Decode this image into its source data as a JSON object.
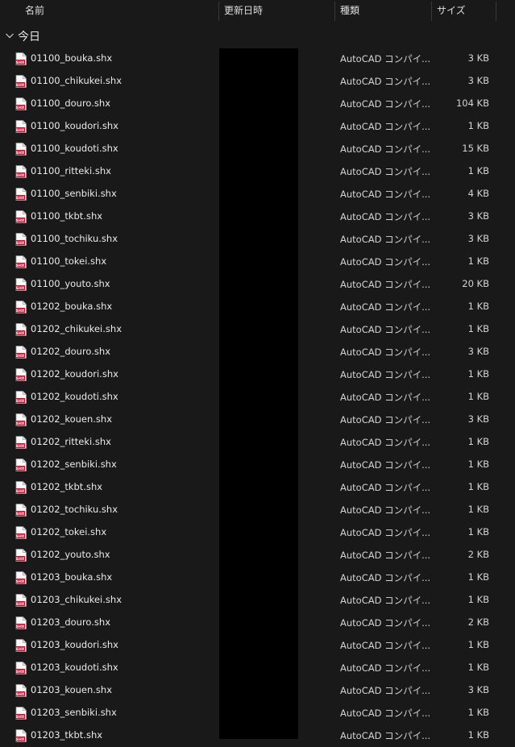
{
  "columns": {
    "name": "名前",
    "date": "更新日時",
    "type": "種類",
    "size": "サイズ"
  },
  "sort_indicator": "^",
  "group": {
    "label": "今日"
  },
  "icon": "shx-file-icon",
  "colors": {
    "background": "#191919",
    "text": "#eaeaea",
    "icon_red": "#c8102e",
    "redaction": "#000000"
  },
  "files": [
    {
      "name": "01100_bouka.shx",
      "type": "AutoCAD コンパイ...",
      "size": "3 KB"
    },
    {
      "name": "01100_chikukei.shx",
      "type": "AutoCAD コンパイ...",
      "size": "3 KB"
    },
    {
      "name": "01100_douro.shx",
      "type": "AutoCAD コンパイ...",
      "size": "104 KB"
    },
    {
      "name": "01100_koudori.shx",
      "type": "AutoCAD コンパイ...",
      "size": "1 KB"
    },
    {
      "name": "01100_koudoti.shx",
      "type": "AutoCAD コンパイ...",
      "size": "15 KB"
    },
    {
      "name": "01100_ritteki.shx",
      "type": "AutoCAD コンパイ...",
      "size": "1 KB"
    },
    {
      "name": "01100_senbiki.shx",
      "type": "AutoCAD コンパイ...",
      "size": "4 KB"
    },
    {
      "name": "01100_tkbt.shx",
      "type": "AutoCAD コンパイ...",
      "size": "3 KB"
    },
    {
      "name": "01100_tochiku.shx",
      "type": "AutoCAD コンパイ...",
      "size": "3 KB"
    },
    {
      "name": "01100_tokei.shx",
      "type": "AutoCAD コンパイ...",
      "size": "1 KB"
    },
    {
      "name": "01100_youto.shx",
      "type": "AutoCAD コンパイ...",
      "size": "20 KB"
    },
    {
      "name": "01202_bouka.shx",
      "type": "AutoCAD コンパイ...",
      "size": "1 KB"
    },
    {
      "name": "01202_chikukei.shx",
      "type": "AutoCAD コンパイ...",
      "size": "1 KB"
    },
    {
      "name": "01202_douro.shx",
      "type": "AutoCAD コンパイ...",
      "size": "3 KB"
    },
    {
      "name": "01202_koudori.shx",
      "type": "AutoCAD コンパイ...",
      "size": "1 KB"
    },
    {
      "name": "01202_koudoti.shx",
      "type": "AutoCAD コンパイ...",
      "size": "1 KB"
    },
    {
      "name": "01202_kouen.shx",
      "type": "AutoCAD コンパイ...",
      "size": "3 KB"
    },
    {
      "name": "01202_ritteki.shx",
      "type": "AutoCAD コンパイ...",
      "size": "1 KB"
    },
    {
      "name": "01202_senbiki.shx",
      "type": "AutoCAD コンパイ...",
      "size": "1 KB"
    },
    {
      "name": "01202_tkbt.shx",
      "type": "AutoCAD コンパイ...",
      "size": "1 KB"
    },
    {
      "name": "01202_tochiku.shx",
      "type": "AutoCAD コンパイ...",
      "size": "1 KB"
    },
    {
      "name": "01202_tokei.shx",
      "type": "AutoCAD コンパイ...",
      "size": "1 KB"
    },
    {
      "name": "01202_youto.shx",
      "type": "AutoCAD コンパイ...",
      "size": "2 KB"
    },
    {
      "name": "01203_bouka.shx",
      "type": "AutoCAD コンパイ...",
      "size": "1 KB"
    },
    {
      "name": "01203_chikukei.shx",
      "type": "AutoCAD コンパイ...",
      "size": "1 KB"
    },
    {
      "name": "01203_douro.shx",
      "type": "AutoCAD コンパイ...",
      "size": "2 KB"
    },
    {
      "name": "01203_koudori.shx",
      "type": "AutoCAD コンパイ...",
      "size": "1 KB"
    },
    {
      "name": "01203_koudoti.shx",
      "type": "AutoCAD コンパイ...",
      "size": "1 KB"
    },
    {
      "name": "01203_kouen.shx",
      "type": "AutoCAD コンパイ...",
      "size": "3 KB"
    },
    {
      "name": "01203_senbiki.shx",
      "type": "AutoCAD コンパイ...",
      "size": "1 KB"
    },
    {
      "name": "01203_tkbt.shx",
      "type": "AutoCAD コンパイ...",
      "size": "1 KB"
    }
  ]
}
